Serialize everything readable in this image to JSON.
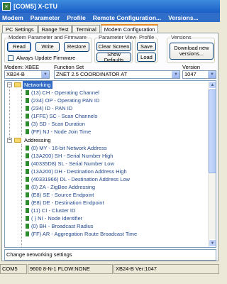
{
  "window": {
    "title": "[COM5] X-CTU"
  },
  "menu": [
    "Modem",
    "Parameter",
    "Profile",
    "Remote Configuration...",
    "Versions..."
  ],
  "tabs": [
    "PC Settings",
    "Range Test",
    "Terminal",
    "Modem Configuration"
  ],
  "groups": {
    "modem_params": "Modem Parameter and Firmware",
    "param_view": "Parameter View",
    "profile": "Profile",
    "versions": "Versions"
  },
  "buttons": {
    "read": "Read",
    "write": "Write",
    "restore": "Restore",
    "clear_screen": "Clear Screen",
    "show_defaults": "Show Defaults",
    "save": "Save",
    "load": "Load",
    "download_line1": "Download new",
    "download_line2": "versions..."
  },
  "always_update": {
    "label": "Always Update Firmware",
    "checked": false
  },
  "modem": {
    "label": "Modem: XBEE",
    "value": "XB24-B"
  },
  "function_set": {
    "label": "Function Set",
    "value": "ZNET 2.5 COORDINATOR AT"
  },
  "version": {
    "label": "Version",
    "value": "1047"
  },
  "tree": {
    "networking": {
      "label": "Networking",
      "items": [
        "(13) CH - Operating Channel",
        "(234) OP - Operating PAN ID",
        "(234) ID - PAN ID",
        "(1FFE) SC - Scan Channels",
        "(3) SD - Scan Duration",
        "(FF) NJ - Node Join Time"
      ]
    },
    "addressing": {
      "label": "Addressing",
      "items": [
        "(0) MY - 16-bit Network Address",
        "(13A200) SH - Serial Number High",
        "(40335D8) SL - Serial Number Low",
        "(13A200) DH - Destination Address High",
        "(40331966) DL - Destination Address Low",
        "(0) ZA - ZigBee Addressing",
        "(E8) SE - Source Endpoint",
        "(E8) DE - Destination Endpoint",
        "(11) CI - Cluster ID",
        "( ) NI - Node Identifier",
        "(0) BH - Broadcast Radius",
        "(FF) AR - Aggregation Route Broadcast Time"
      ]
    }
  },
  "description": "Change networking settings",
  "status": [
    "COM5",
    "9600 8-N-1  FLOW:NONE",
    "XB24-B  Ver:1047"
  ]
}
